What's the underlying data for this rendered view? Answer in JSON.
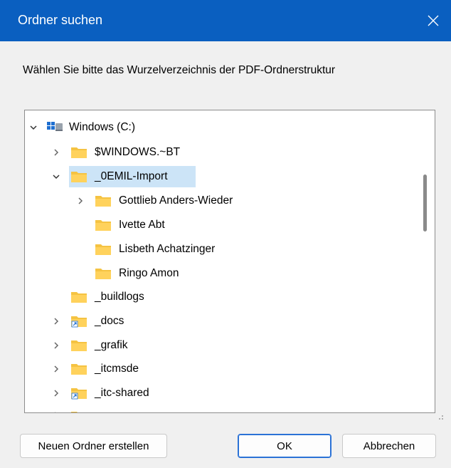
{
  "dialog": {
    "title": "Ordner suchen",
    "instruction": "Wählen Sie bitte das Wurzelverzeichnis der PDF-Ordnerstruktur"
  },
  "tree": {
    "root": {
      "label": "Windows (C:)",
      "icon": "drive-icon",
      "expanded": true
    },
    "items": [
      {
        "label": "$WINDOWS.~BT",
        "icon": "folder-icon",
        "expander": "collapsed"
      },
      {
        "label": "_0EMIL-Import",
        "icon": "folder-icon",
        "expander": "expanded",
        "selected": true
      },
      {
        "label": "Gottlieb Anders-Wieder",
        "icon": "folder-icon",
        "expander": "collapsed"
      },
      {
        "label": "Ivette Abt",
        "icon": "folder-icon",
        "expander": "none"
      },
      {
        "label": "Lisbeth Achatzinger",
        "icon": "folder-icon",
        "expander": "none"
      },
      {
        "label": "Ringo Amon",
        "icon": "folder-icon",
        "expander": "none"
      },
      {
        "label": "_buildlogs",
        "icon": "folder-icon",
        "expander": "none"
      },
      {
        "label": "_docs",
        "icon": "shortcut-folder-icon",
        "expander": "collapsed"
      },
      {
        "label": "_grafik",
        "icon": "folder-icon",
        "expander": "collapsed"
      },
      {
        "label": "_itcmsde",
        "icon": "folder-icon",
        "expander": "collapsed"
      },
      {
        "label": "_itc-shared",
        "icon": "shortcut-folder-icon",
        "expander": "collapsed"
      }
    ]
  },
  "buttons": {
    "new_folder": "Neuen Ordner erstellen",
    "ok": "OK",
    "cancel": "Abbrechen"
  },
  "colors": {
    "titlebar": "#0a5fc0",
    "selection": "#cce4f7",
    "folder": "#f5c342",
    "default_button_border": "#2b72d6"
  }
}
